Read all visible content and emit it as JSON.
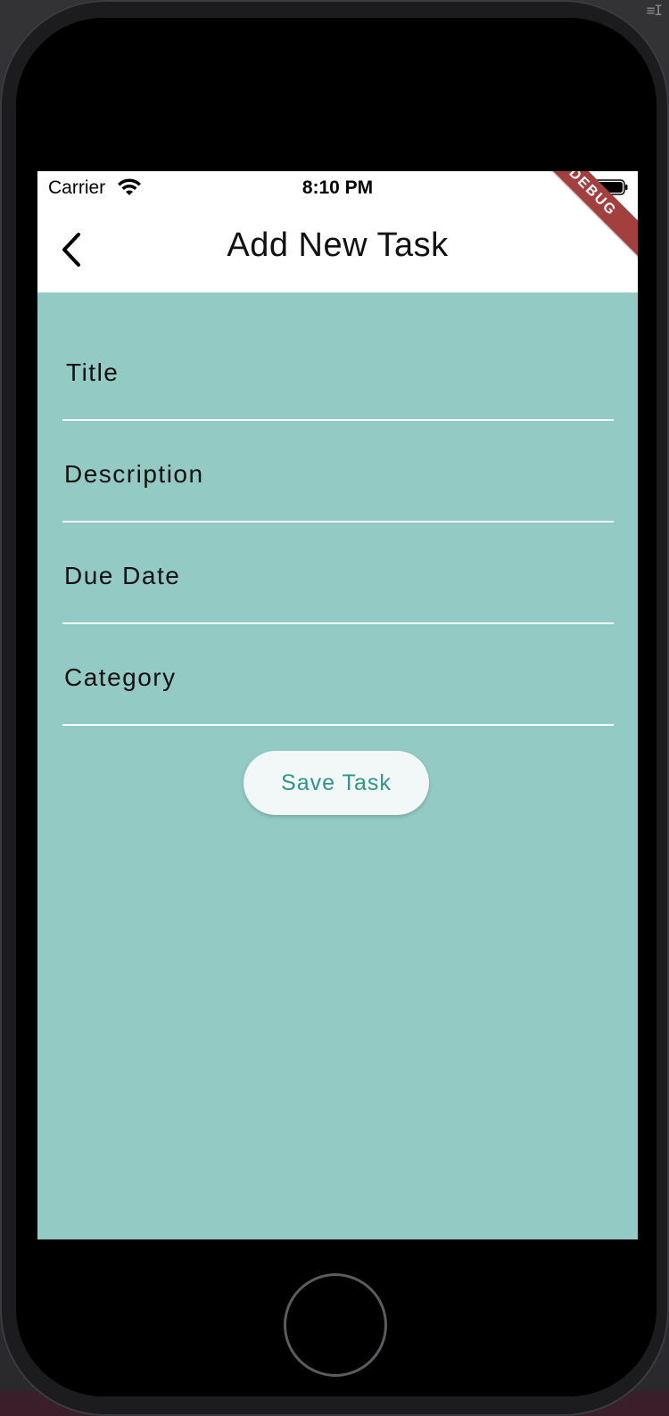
{
  "status_bar": {
    "carrier": "Carrier",
    "time": "8:10 PM",
    "wifi_icon": "wifi-icon",
    "battery_icon": "battery-icon"
  },
  "app_bar": {
    "back_icon": "chevron-left-icon",
    "title": "Add New Task"
  },
  "debug_banner": "DEBUG",
  "form": {
    "fields": [
      {
        "label": "Title"
      },
      {
        "label": "Description"
      },
      {
        "label": "Due Date"
      },
      {
        "label": "Category"
      }
    ],
    "save_label": "Save Task"
  },
  "colors": {
    "screen_background": "#93cac4",
    "app_bar_background": "#ffffff",
    "button_text": "#2f9586",
    "debug_banner": "#a3403f"
  }
}
